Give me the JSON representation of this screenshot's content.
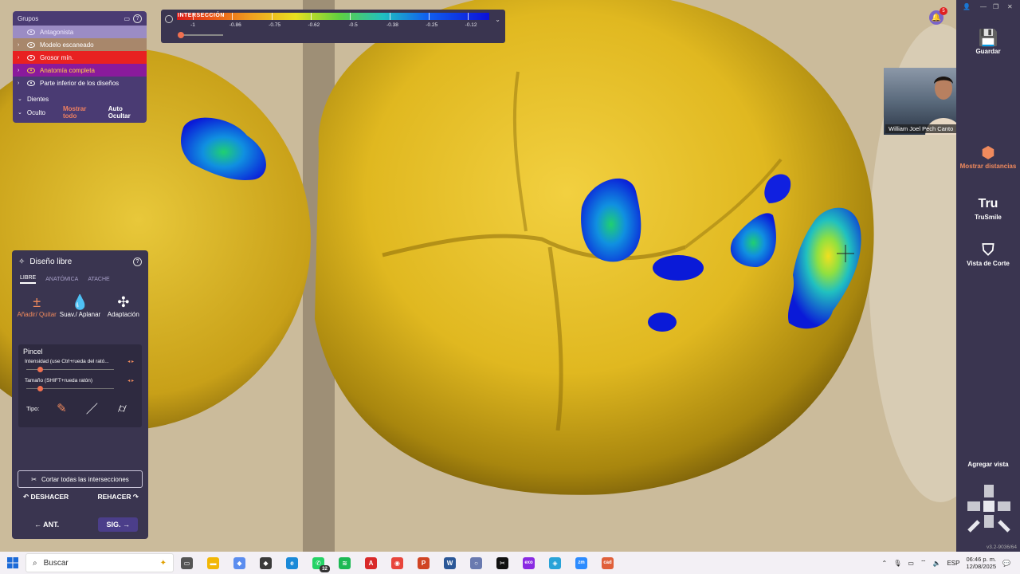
{
  "groups_panel": {
    "title": "Grupos",
    "items": [
      {
        "label": "Antagonista"
      },
      {
        "label": "Modelo escaneado"
      },
      {
        "label": "Grosor mín."
      },
      {
        "label": "Anatomía completa"
      },
      {
        "label": "Parte inferior de los diseños"
      }
    ],
    "teeth_label": "Dientes",
    "hidden_label": "Oculto",
    "show_all_label": "Mostrar todo",
    "auto_hide_label": "Auto Ocultar"
  },
  "colorbar": {
    "title": "INTERSECCIÓN",
    "ticks": [
      "-1",
      "-0.86",
      "-0.75",
      "-0.62",
      "-0.5",
      "-0.38",
      "-0.25",
      "-0.12"
    ]
  },
  "design_panel": {
    "title": "Diseño libre",
    "tabs": [
      "LIBRE",
      "ANATÓMICA",
      "ATACHE"
    ],
    "tools": [
      {
        "label": "Añadir/ Quitar",
        "icon": "add-remove-icon"
      },
      {
        "label": "Suav./ Aplanar",
        "icon": "drop-icon"
      },
      {
        "label": "Adaptación",
        "icon": "adapt-icon"
      }
    ],
    "brush_label": "Pincel",
    "intensity_label": "Intensidad (use Ctrl+rueda del rató...",
    "size_label": "Tamaño (SHIFT+rueda ratón)",
    "intensity_value": 0.15,
    "size_value": 0.15,
    "type_label": "Tipo:",
    "cut_label": "Cortar todas las intersecciones",
    "undo_label": "DESHACER",
    "redo_label": "REHACER",
    "prev_label": "ANT.",
    "next_label": "SIG."
  },
  "right_bar": {
    "save_label": "Guardar",
    "distances_label": "Mostrar distancias",
    "trusmile_label": "TruSmile",
    "trusmile_icon_text": "Tru",
    "cut_view_label": "Vista de Corte",
    "add_view_label": "Agregar vista",
    "version": "v3.2-9036/64"
  },
  "video": {
    "name": "William Joel Pech Canto"
  },
  "notification_count": "5",
  "taskbar": {
    "search_placeholder": "Buscar",
    "whatsapp_badge": "32",
    "apps": [
      {
        "name": "task-view",
        "color": "#555555",
        "glyph": "▭"
      },
      {
        "name": "file-explorer",
        "color": "#f2b705",
        "glyph": "▬"
      },
      {
        "name": "copilot",
        "color": "#5b8def",
        "glyph": "◆"
      },
      {
        "name": "app-diamond",
        "color": "#3a3a3a",
        "glyph": "◆"
      },
      {
        "name": "edge",
        "color": "#1b8ad8",
        "glyph": "e"
      },
      {
        "name": "whatsapp",
        "color": "#25d366",
        "glyph": "✆"
      },
      {
        "name": "spotify",
        "color": "#1db954",
        "glyph": "≋"
      },
      {
        "name": "acrobat",
        "color": "#d92a2a",
        "glyph": "A"
      },
      {
        "name": "chrome",
        "color": "#e8453c",
        "glyph": "◉"
      },
      {
        "name": "powerpoint",
        "color": "#d04423",
        "glyph": "P"
      },
      {
        "name": "word",
        "color": "#2b5797",
        "glyph": "W"
      },
      {
        "name": "circle-app",
        "color": "#6a7ab0",
        "glyph": "○"
      },
      {
        "name": "capcut",
        "color": "#111111",
        "glyph": "✂"
      },
      {
        "name": "exocad",
        "color": "#8a2be2",
        "glyph": "exo"
      },
      {
        "name": "cube-app",
        "color": "#29a3d8",
        "glyph": "◈"
      },
      {
        "name": "zoom",
        "color": "#2d8cff",
        "glyph": "zm"
      },
      {
        "name": "dental-app",
        "color": "#e0603a",
        "glyph": "cad"
      }
    ],
    "language": "ESP",
    "time": "06:46 p. m.",
    "date": "12/08/2025"
  }
}
